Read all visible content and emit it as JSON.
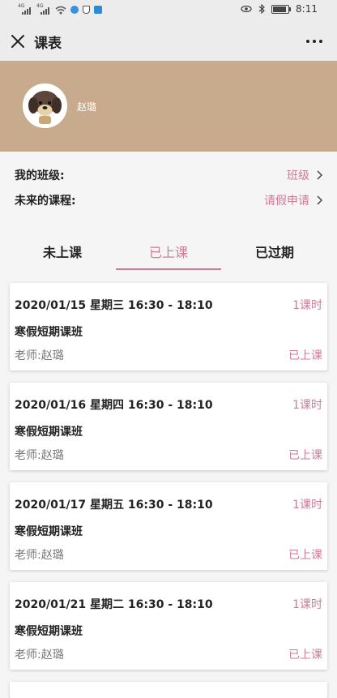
{
  "status_bar": {
    "time": "8:11",
    "network_label": "4G"
  },
  "header": {
    "title": "课表"
  },
  "profile": {
    "name": "赵璐"
  },
  "info": {
    "class_label": "我的班级:",
    "class_value": "班级",
    "future_label": "未来的课程:",
    "future_value": "请假申请"
  },
  "tabs": [
    {
      "label": "未上课",
      "active": false
    },
    {
      "label": "已上课",
      "active": true
    },
    {
      "label": "已过期",
      "active": false
    }
  ],
  "courses": [
    {
      "time": "2020/01/15  星期三  16:30 - 18:10",
      "hours": "1课时",
      "name": "寒假短期课班",
      "teacher": "老师:赵璐",
      "status": "已上课"
    },
    {
      "time": "2020/01/16  星期四  16:30 - 18:10",
      "hours": "1课时",
      "name": "寒假短期课班",
      "teacher": "老师:赵璐",
      "status": "已上课"
    },
    {
      "time": "2020/01/17  星期五  16:30 - 18:10",
      "hours": "1课时",
      "name": "寒假短期课班",
      "teacher": "老师:赵璐",
      "status": "已上课"
    },
    {
      "time": "2020/01/21  星期二  16:30 - 18:10",
      "hours": "1课时",
      "name": "寒假短期课班",
      "teacher": "老师:赵璐",
      "status": "已上课"
    }
  ],
  "colors": {
    "accent": "#cf7a97",
    "banner": "#c8aa8c",
    "bar": "#ececec"
  }
}
